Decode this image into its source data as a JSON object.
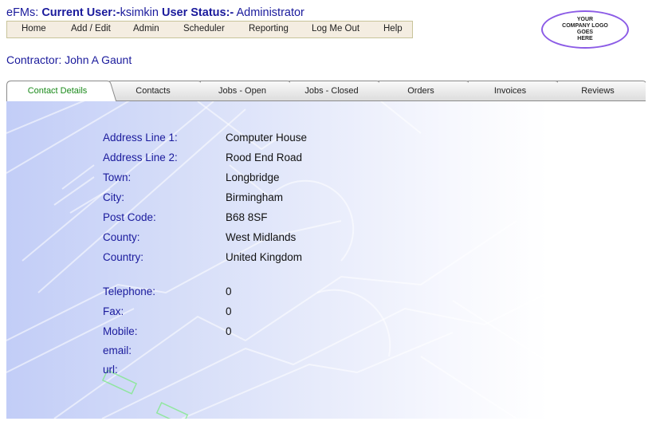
{
  "header": {
    "app_name": "eFMs:",
    "current_user_label": "Current User:-",
    "current_user": "ksimkin",
    "user_status_label": "User Status:-",
    "user_status": "Administrator"
  },
  "nav": {
    "items": [
      {
        "label": "Home"
      },
      {
        "label": "Add / Edit"
      },
      {
        "label": "Admin"
      },
      {
        "label": "Scheduler"
      },
      {
        "label": "Reporting"
      },
      {
        "label": "Log Me Out"
      },
      {
        "label": "Help"
      }
    ]
  },
  "logo": {
    "lines": [
      "YOUR",
      "COMPANY LOGO",
      "GOES",
      "HERE"
    ]
  },
  "contractor": {
    "label": "Contractor: John A Gaunt"
  },
  "tabs": [
    {
      "label": "Contact Details",
      "active": true
    },
    {
      "label": "Contacts",
      "active": false
    },
    {
      "label": "Jobs - Open",
      "active": false
    },
    {
      "label": "Jobs - Closed",
      "active": false
    },
    {
      "label": "Orders",
      "active": false
    },
    {
      "label": "Invoices",
      "active": false
    },
    {
      "label": "Reviews",
      "active": false
    }
  ],
  "contact_details": {
    "address": [
      {
        "label": "Address Line 1:",
        "value": "Computer House"
      },
      {
        "label": "Address Line 2:",
        "value": "Rood End Road"
      },
      {
        "label": "Town:",
        "value": "Longbridge"
      },
      {
        "label": "City:",
        "value": "Birmingham"
      },
      {
        "label": "Post Code:",
        "value": "B68 8SF"
      },
      {
        "label": "County:",
        "value": "West Midlands"
      },
      {
        "label": "Country:",
        "value": "United Kingdom"
      }
    ],
    "contact": [
      {
        "label": "Telephone:",
        "value": "0"
      },
      {
        "label": "Fax:",
        "value": "0"
      },
      {
        "label": "Mobile:",
        "value": "0"
      },
      {
        "label": "email:",
        "value": ""
      },
      {
        "label": "url:",
        "value": ""
      }
    ]
  },
  "colors": {
    "label_blue": "#1a1a9c",
    "active_tab_green": "#1a8a1a",
    "navbar_bg": "#f4ede1",
    "logo_border": "#8c5ce6"
  }
}
